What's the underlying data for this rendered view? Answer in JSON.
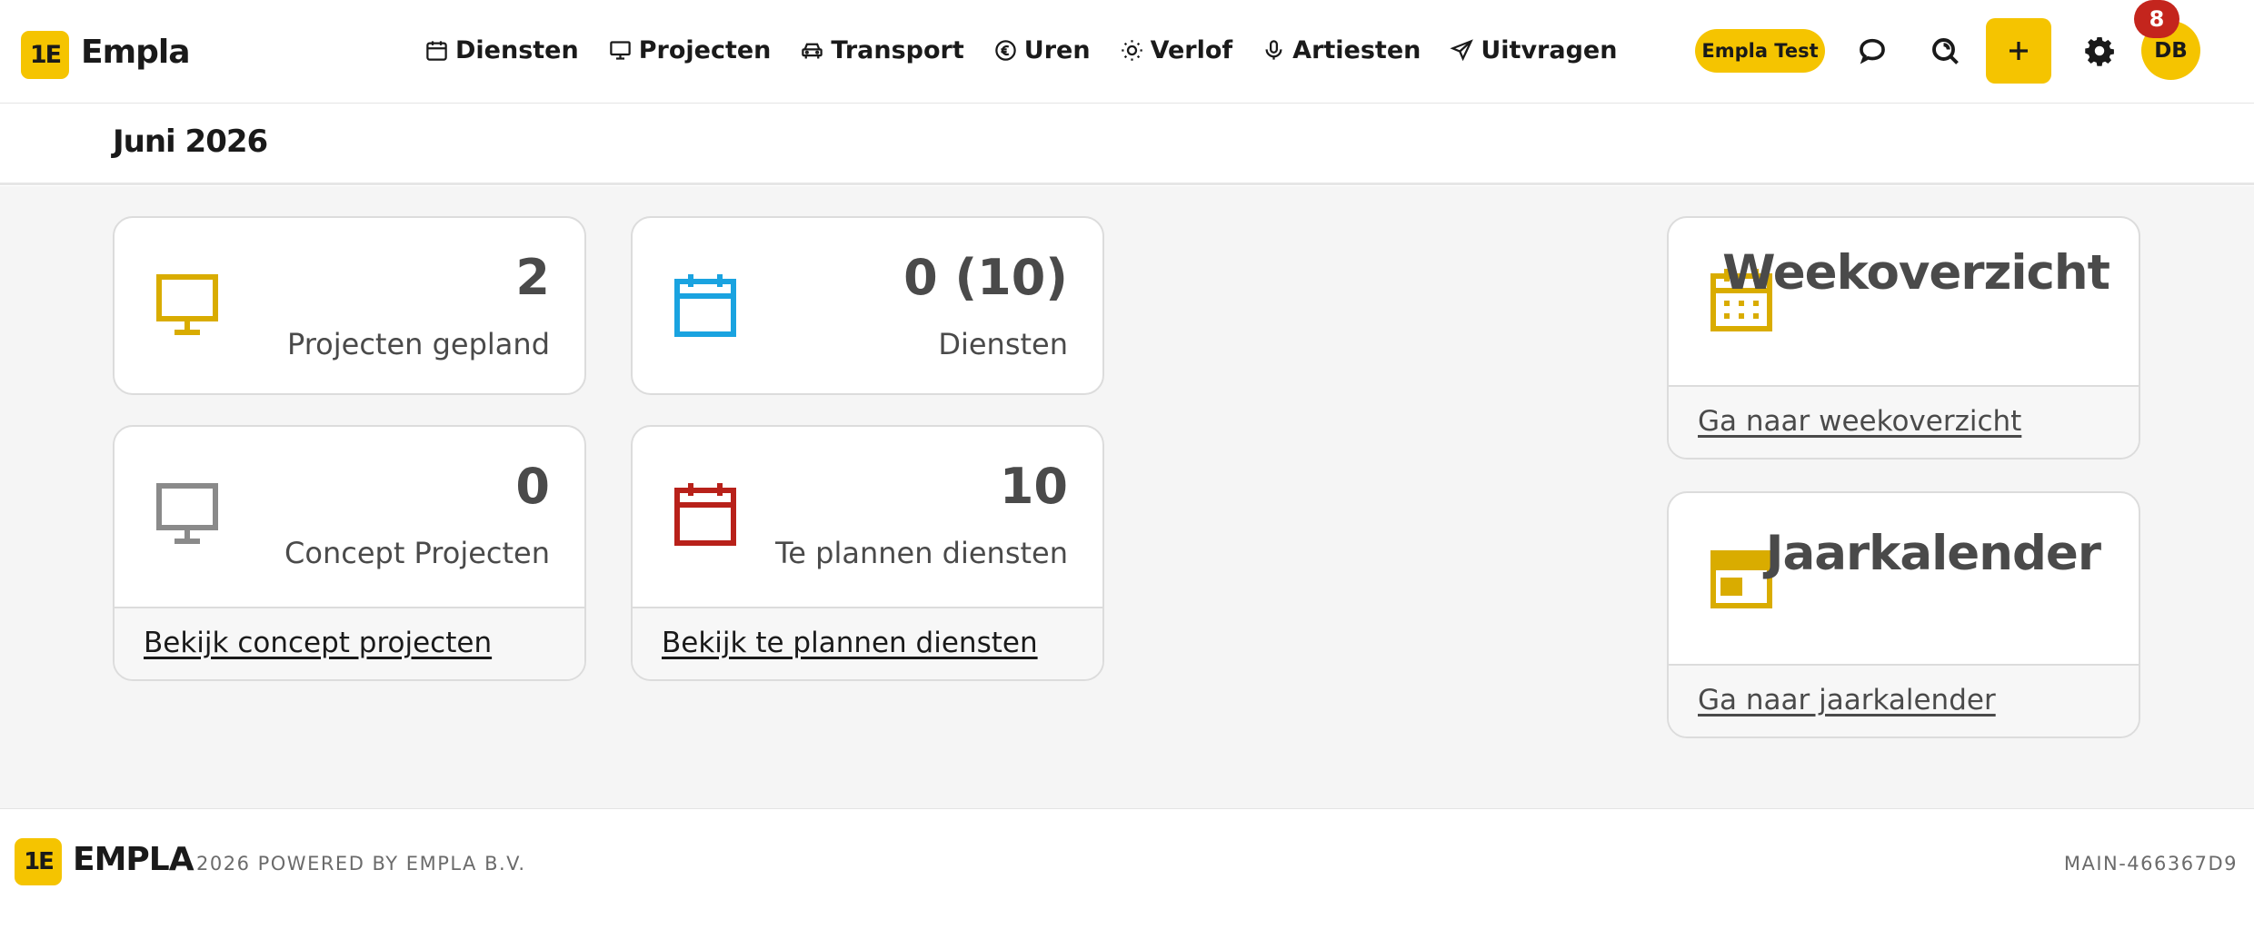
{
  "brand": {
    "name": "Empla",
    "logo_text": "1E"
  },
  "nav": [
    {
      "label": "Diensten",
      "icon": "calendar-icon"
    },
    {
      "label": "Projecten",
      "icon": "monitor-icon"
    },
    {
      "label": "Transport",
      "icon": "car-icon"
    },
    {
      "label": "Uren",
      "icon": "euro-icon"
    },
    {
      "label": "Verlof",
      "icon": "sun-icon"
    },
    {
      "label": "Artiesten",
      "icon": "microphone-icon"
    },
    {
      "label": "Uitvragen",
      "icon": "send-icon"
    }
  ],
  "header": {
    "environment": "Empla Test",
    "avatar_initials": "DB",
    "notification_count": "8"
  },
  "page": {
    "month": "Juni 2026"
  },
  "cards": {
    "projects_planned": {
      "value": "2",
      "label": "Projecten gepland"
    },
    "services": {
      "value": "0 (10)",
      "label": "Diensten"
    },
    "concept_projects": {
      "value": "0",
      "label": "Concept Projecten",
      "link": "Bekijk concept projecten"
    },
    "services_to_plan": {
      "value": "10",
      "label": "Te plannen diensten",
      "link": "Bekijk te plannen diensten"
    }
  },
  "widgets": {
    "week": {
      "title": "Weekoverzicht",
      "link": "Ga naar weekoverzicht"
    },
    "year": {
      "title": "Jaarkalender",
      "link": "Ga naar jaarkalender"
    }
  },
  "footer": {
    "logo_text": "1E",
    "brand": "EMPLA",
    "powered": "2026 POWERED BY EMPLA B.V.",
    "version": "MAIN-466367D9"
  },
  "colors": {
    "accent": "#f5c400",
    "blue": "#1aa3e0",
    "red": "#b8211a",
    "gray": "#8a8a8a",
    "badge": "#c4251d"
  }
}
